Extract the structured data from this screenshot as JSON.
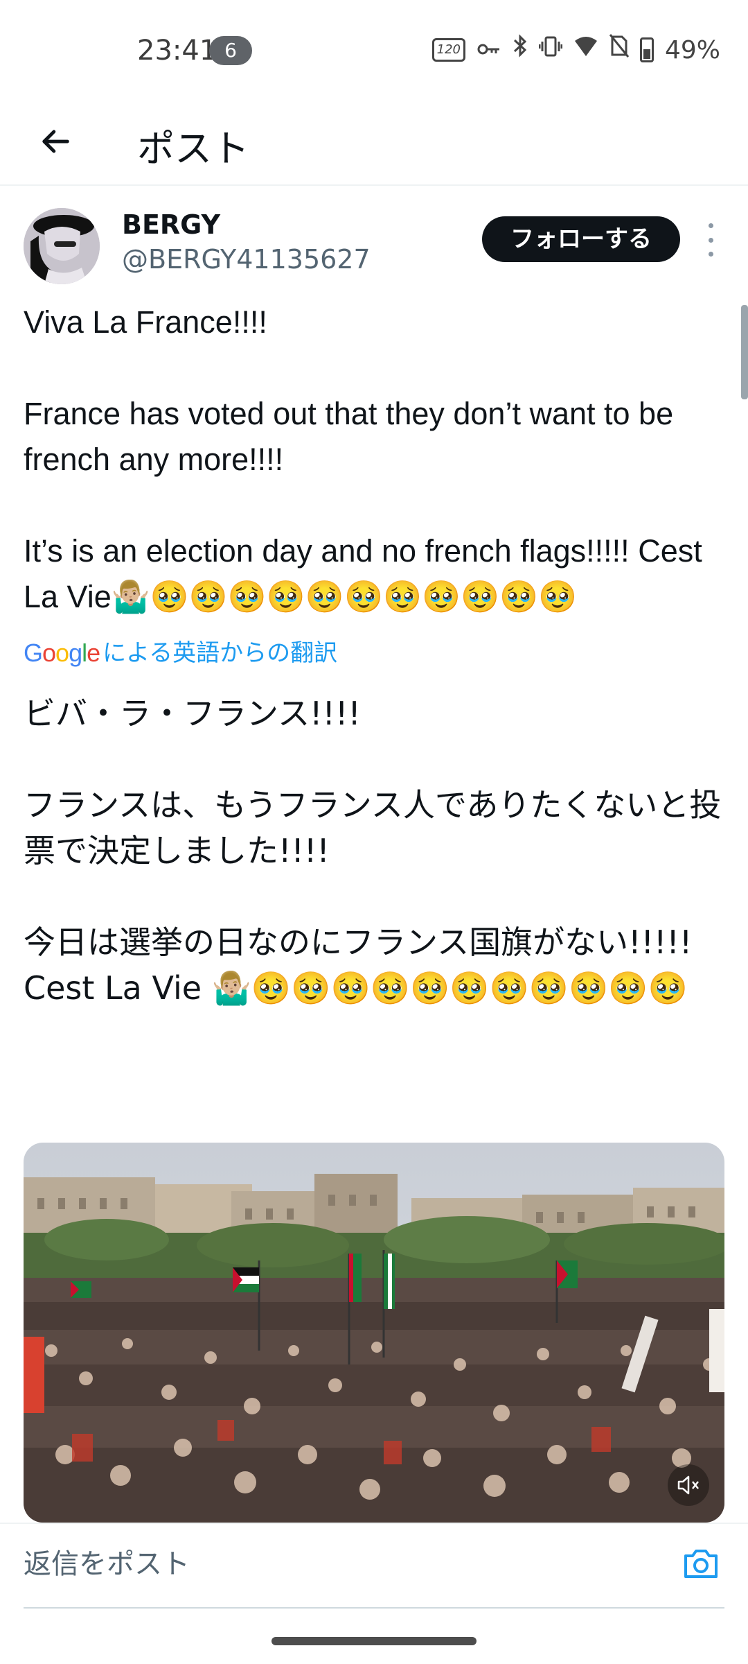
{
  "status_bar": {
    "time": "23:41",
    "notification_count": "6",
    "refresh_rate": "120",
    "battery": "49%"
  },
  "header": {
    "title": "ポスト"
  },
  "post": {
    "author_name": "BERGY",
    "author_handle": "@BERGY41135627",
    "follow_label": "フォローする",
    "text": "Viva La France!!!!\n\nFrance has voted out that they don’t want to be french any more!!!!\n\nIt’s is an election day and no french flags!!!!! Cest La Vie🤷🏼‍♂️🥹🥹🥹🥹🥹🥹🥹🥹🥹🥹🥹",
    "translation_provider": "Google",
    "translation_label": "による英語からの翻訳",
    "translated_text": "ビバ・ラ・フランス!!!!\n\nフランスは、もうフランス人でありたくないと投票で決定しました!!!!\n\n今日は選挙の日なのにフランス国旗がない!!!!! Cest La Vie 🤷🏼‍♂️🥹🥹🥹🥹🥹🥹🥹🥹🥹🥹🥹"
  },
  "reply": {
    "placeholder": "返信をポスト"
  },
  "icons": {
    "back": "arrow-left-icon",
    "more": "more-vertical-icon",
    "mute": "volume-muted-icon",
    "camera": "camera-icon"
  },
  "colors": {
    "accent": "#1d9bf0",
    "follow_button": "#0f1419",
    "secondary_text": "#536471"
  }
}
